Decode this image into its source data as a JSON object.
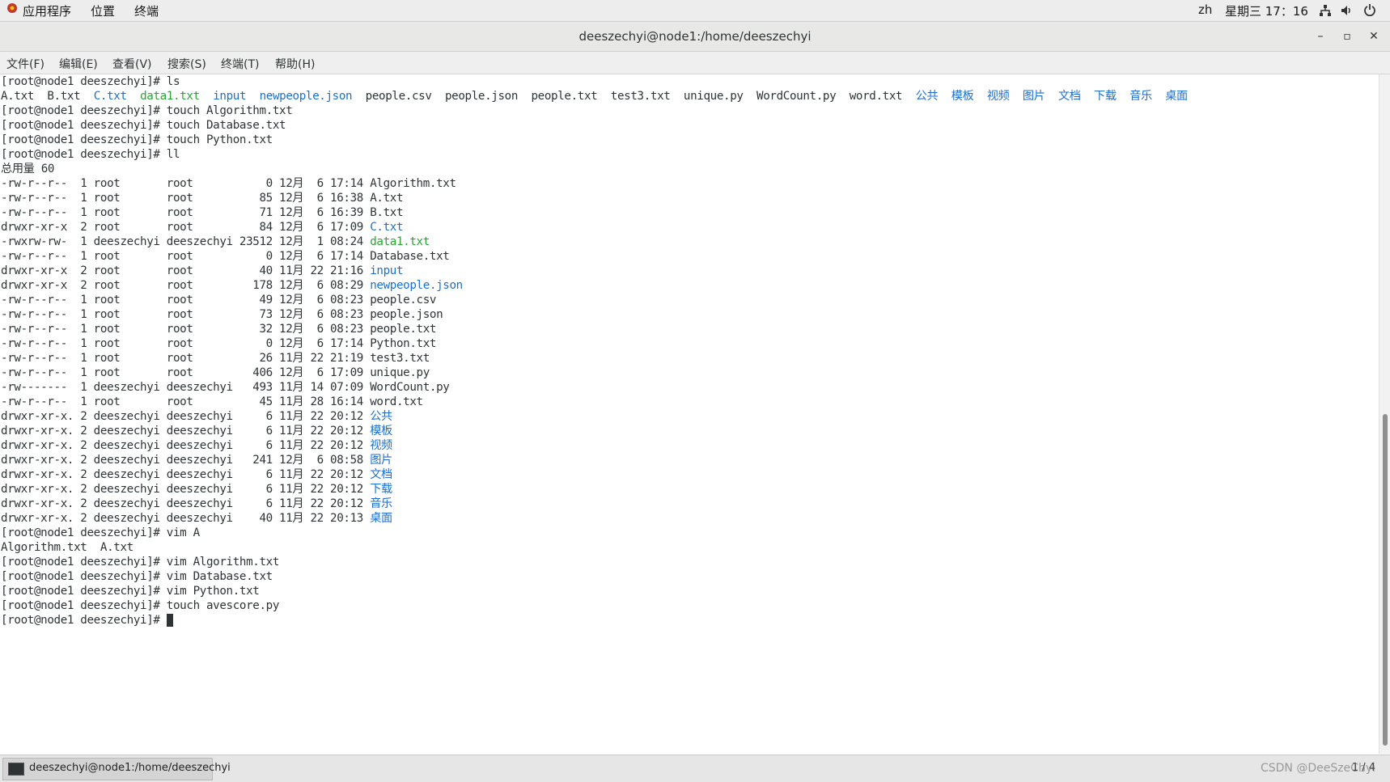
{
  "topbar": {
    "apps_label": "应用程序",
    "places_label": "位置",
    "terminal_label": "终端",
    "lang": "zh",
    "clock": "星期三 17：16"
  },
  "window": {
    "title": "deeszechyi@node1:/home/deeszechyi",
    "minimize": "–",
    "maximize": "▫",
    "close": "✕"
  },
  "menu": {
    "file": "文件(F)",
    "edit": "编辑(E)",
    "view": "查看(V)",
    "search": "搜索(S)",
    "terminal": "终端(T)",
    "help": "帮助(H)"
  },
  "terminal": {
    "prompt": "[root@node1 deeszechyi]# ",
    "cmd_ls": "ls",
    "ls_output": [
      {
        "text": "A.txt",
        "color": "default"
      },
      {
        "text": "B.txt",
        "color": "default"
      },
      {
        "text": "C.txt",
        "color": "blue"
      },
      {
        "text": "data1.txt",
        "color": "green"
      },
      {
        "text": "input",
        "color": "blue"
      },
      {
        "text": "newpeople.json",
        "color": "blue"
      },
      {
        "text": "people.csv",
        "color": "default"
      },
      {
        "text": "people.json",
        "color": "default"
      },
      {
        "text": "people.txt",
        "color": "default"
      },
      {
        "text": "test3.txt",
        "color": "default"
      },
      {
        "text": "unique.py",
        "color": "default"
      },
      {
        "text": "WordCount.py",
        "color": "default"
      },
      {
        "text": "word.txt",
        "color": "default"
      },
      {
        "text": "公共",
        "color": "blue"
      },
      {
        "text": "模板",
        "color": "blue"
      },
      {
        "text": "视频",
        "color": "blue"
      },
      {
        "text": "图片",
        "color": "blue"
      },
      {
        "text": "文档",
        "color": "blue"
      },
      {
        "text": "下载",
        "color": "blue"
      },
      {
        "text": "音乐",
        "color": "blue"
      },
      {
        "text": "桌面",
        "color": "blue"
      }
    ],
    "commands_1": [
      "touch Algorithm.txt",
      "touch Database.txt",
      "touch Python.txt",
      "ll"
    ],
    "total": "总用量 60",
    "ll_rows": [
      {
        "perm": "-rw-r--r--",
        "links": "1",
        "owner": "root",
        "group": "root",
        "size": "0",
        "date": "12月  6 17:14",
        "name": "Algorithm.txt",
        "color": "default"
      },
      {
        "perm": "-rw-r--r--",
        "links": "1",
        "owner": "root",
        "group": "root",
        "size": "85",
        "date": "12月  6 16:38",
        "name": "A.txt",
        "color": "default"
      },
      {
        "perm": "-rw-r--r--",
        "links": "1",
        "owner": "root",
        "group": "root",
        "size": "71",
        "date": "12月  6 16:39",
        "name": "B.txt",
        "color": "default"
      },
      {
        "perm": "drwxr-xr-x",
        "links": "2",
        "owner": "root",
        "group": "root",
        "size": "84",
        "date": "12月  6 17:09",
        "name": "C.txt",
        "color": "blue"
      },
      {
        "perm": "-rwxrw-rw-",
        "links": "1",
        "owner": "deeszechyi",
        "group": "deeszechyi",
        "size": "23512",
        "date": "12月  1 08:24",
        "name": "data1.txt",
        "color": "green"
      },
      {
        "perm": "-rw-r--r--",
        "links": "1",
        "owner": "root",
        "group": "root",
        "size": "0",
        "date": "12月  6 17:14",
        "name": "Database.txt",
        "color": "default"
      },
      {
        "perm": "drwxr-xr-x",
        "links": "2",
        "owner": "root",
        "group": "root",
        "size": "40",
        "date": "11月 22 21:16",
        "name": "input",
        "color": "blue"
      },
      {
        "perm": "drwxr-xr-x",
        "links": "2",
        "owner": "root",
        "group": "root",
        "size": "178",
        "date": "12月  6 08:29",
        "name": "newpeople.json",
        "color": "blue"
      },
      {
        "perm": "-rw-r--r--",
        "links": "1",
        "owner": "root",
        "group": "root",
        "size": "49",
        "date": "12月  6 08:23",
        "name": "people.csv",
        "color": "default"
      },
      {
        "perm": "-rw-r--r--",
        "links": "1",
        "owner": "root",
        "group": "root",
        "size": "73",
        "date": "12月  6 08:23",
        "name": "people.json",
        "color": "default"
      },
      {
        "perm": "-rw-r--r--",
        "links": "1",
        "owner": "root",
        "group": "root",
        "size": "32",
        "date": "12月  6 08:23",
        "name": "people.txt",
        "color": "default"
      },
      {
        "perm": "-rw-r--r--",
        "links": "1",
        "owner": "root",
        "group": "root",
        "size": "0",
        "date": "12月  6 17:14",
        "name": "Python.txt",
        "color": "default"
      },
      {
        "perm": "-rw-r--r--",
        "links": "1",
        "owner": "root",
        "group": "root",
        "size": "26",
        "date": "11月 22 21:19",
        "name": "test3.txt",
        "color": "default"
      },
      {
        "perm": "-rw-r--r--",
        "links": "1",
        "owner": "root",
        "group": "root",
        "size": "406",
        "date": "12月  6 17:09",
        "name": "unique.py",
        "color": "default"
      },
      {
        "perm": "-rw-------",
        "links": "1",
        "owner": "deeszechyi",
        "group": "deeszechyi",
        "size": "493",
        "date": "11月 14 07:09",
        "name": "WordCount.py",
        "color": "default"
      },
      {
        "perm": "-rw-r--r--",
        "links": "1",
        "owner": "root",
        "group": "root",
        "size": "45",
        "date": "11月 28 16:14",
        "name": "word.txt",
        "color": "default"
      },
      {
        "perm": "drwxr-xr-x.",
        "links": "2",
        "owner": "deeszechyi",
        "group": "deeszechyi",
        "size": "6",
        "date": "11月 22 20:12",
        "name": "公共",
        "color": "blue"
      },
      {
        "perm": "drwxr-xr-x.",
        "links": "2",
        "owner": "deeszechyi",
        "group": "deeszechyi",
        "size": "6",
        "date": "11月 22 20:12",
        "name": "模板",
        "color": "blue"
      },
      {
        "perm": "drwxr-xr-x.",
        "links": "2",
        "owner": "deeszechyi",
        "group": "deeszechyi",
        "size": "6",
        "date": "11月 22 20:12",
        "name": "视频",
        "color": "blue"
      },
      {
        "perm": "drwxr-xr-x.",
        "links": "2",
        "owner": "deeszechyi",
        "group": "deeszechyi",
        "size": "241",
        "date": "12月  6 08:58",
        "name": "图片",
        "color": "blue"
      },
      {
        "perm": "drwxr-xr-x.",
        "links": "2",
        "owner": "deeszechyi",
        "group": "deeszechyi",
        "size": "6",
        "date": "11月 22 20:12",
        "name": "文档",
        "color": "blue"
      },
      {
        "perm": "drwxr-xr-x.",
        "links": "2",
        "owner": "deeszechyi",
        "group": "deeszechyi",
        "size": "6",
        "date": "11月 22 20:12",
        "name": "下载",
        "color": "blue"
      },
      {
        "perm": "drwxr-xr-x.",
        "links": "2",
        "owner": "deeszechyi",
        "group": "deeszechyi",
        "size": "6",
        "date": "11月 22 20:12",
        "name": "音乐",
        "color": "blue"
      },
      {
        "perm": "drwxr-xr-x.",
        "links": "2",
        "owner": "deeszechyi",
        "group": "deeszechyi",
        "size": "40",
        "date": "11月 22 20:13",
        "name": "桌面",
        "color": "blue"
      }
    ],
    "cmd_vim_a": "vim A",
    "completion": [
      "Algorithm.txt",
      "A.txt"
    ],
    "commands_2": [
      "vim Algorithm.txt",
      "vim Database.txt",
      "vim Python.txt",
      "touch avescore.py"
    ]
  },
  "taskbar": {
    "task_label": "deeszechyi@node1:/home/deeszechyi",
    "pager": "1 / 4",
    "watermark": "CSDN @DeeSzeChyi"
  },
  "colors": {
    "blue": "#1c6fd1",
    "green": "#26a632",
    "text": "#2e3436"
  }
}
